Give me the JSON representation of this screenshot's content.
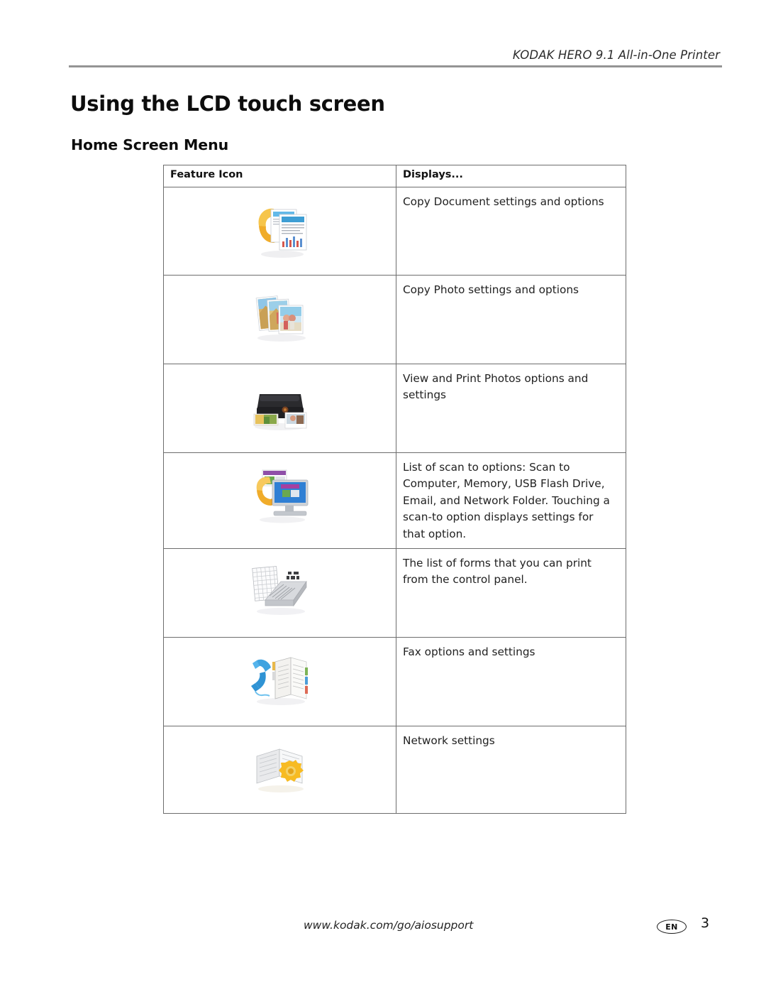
{
  "header": {
    "running_head": "KODAK HERO 9.1 All-in-One Printer"
  },
  "title": "Using the LCD touch screen",
  "subtitle": "Home Screen Menu",
  "table": {
    "columns": [
      "Feature Icon",
      "Displays..."
    ],
    "rows": [
      {
        "icon_name": "copy-document-icon",
        "description": "Copy Document settings and options"
      },
      {
        "icon_name": "copy-photo-icon",
        "description": "Copy Photo settings and options"
      },
      {
        "icon_name": "view-print-photos-icon",
        "description": "View and Print Photos options and settings"
      },
      {
        "icon_name": "scan-icon",
        "description": "List of scan to options: Scan to Computer, Memory, USB Flash Drive, Email, and Network Folder. Touching a scan-to option displays settings for that option."
      },
      {
        "icon_name": "printable-forms-icon",
        "description": "The list of forms that you can print from the control panel."
      },
      {
        "icon_name": "fax-icon",
        "description": "Fax options and settings"
      },
      {
        "icon_name": "network-settings-icon",
        "description": "Network settings"
      }
    ]
  },
  "footer": {
    "url": "www.kodak.com/go/aiosupport",
    "language_badge": "EN",
    "page_number": "3"
  },
  "colors": {
    "rule": "#949494",
    "table_border": "#6d6d6d",
    "text": "#1a1a1a",
    "icon_accent_orange": "#f4b41a",
    "icon_accent_blue": "#4aa3dd"
  }
}
